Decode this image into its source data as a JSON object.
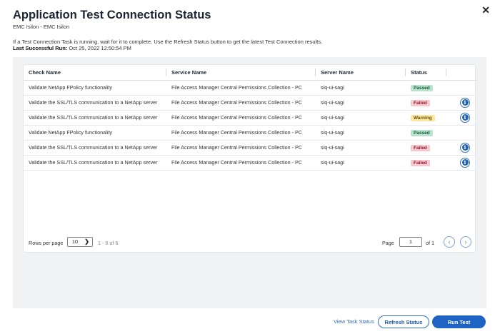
{
  "header": {
    "title": "Application Test Connection Status",
    "subtitle": "EMC Isilon - EMC Isilon",
    "info": "If a Test Connection Task is running, wait for it to complete. Use the Refresh Status button to get the latest Test Connection results.",
    "last_run_label": "Last Successful Run:",
    "last_run_value": "Oct 25, 2022 12:50:54 PM",
    "close_icon": "close-icon"
  },
  "table": {
    "columns": [
      "Check Name",
      "Service Name",
      "Server Name",
      "Status",
      ""
    ],
    "rows": [
      {
        "check": "Validate NetApp FPolicy functionality",
        "service": "File Access Manager Central Permissions Collection - PC",
        "server": "siq-ui-sagi",
        "status": "Passed",
        "info": false
      },
      {
        "check": "Validate the SSL/TLS communication to a NetApp server",
        "service": "File Access Manager Central Permissions Collection - PC",
        "server": "siq-ui-sagi",
        "status": "Failed",
        "info": true
      },
      {
        "check": "Validate the SSL/TLS communication to a NetApp server",
        "service": "File Access Manager Central Permissions Collection - PC",
        "server": "siq-ui-sagi",
        "status": "Warning",
        "info": true
      },
      {
        "check": "Validate NetApp FPolicy functionality",
        "service": "File Access Manager Central Permissions Collection - PC",
        "server": "siq-ui-sagi",
        "status": "Passed",
        "info": false
      },
      {
        "check": "Validate the SSL/TLS communication to a NetApp server",
        "service": "File Access Manager Central Permissions Collection - PC",
        "server": "siq-ui-sagi",
        "status": "Failed",
        "info": true
      },
      {
        "check": "Validate the SSL/TLS communication to a NetApp server",
        "service": "File Access Manager Central Permissions Collection - PC",
        "server": "siq-ui-sagi",
        "status": "Failed",
        "info": true
      }
    ]
  },
  "pager": {
    "rows_label": "Rows per page",
    "rows_value": "10",
    "range": "1 - 6 of 6",
    "page_label": "Page",
    "page_value": "1",
    "of_label": "of 1"
  },
  "footer": {
    "view_task": "View Task Status",
    "refresh": "Refresh Status",
    "run": "Run Test"
  },
  "colors": {
    "primary": "#1f64c4",
    "passed_bg": "#b9e3cf",
    "failed_bg": "#f7c7cf",
    "warning_bg": "#fbe7a4"
  }
}
